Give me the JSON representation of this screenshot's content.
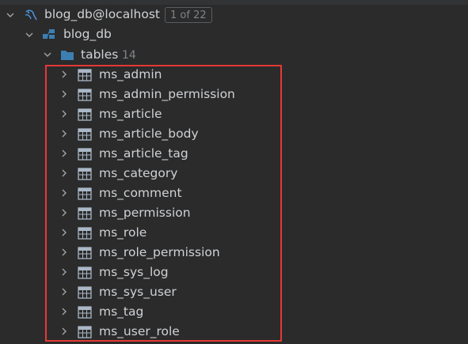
{
  "datasource": {
    "name": "blog_db@localhost",
    "badge": "1 of 22",
    "icon": "datasource-icon"
  },
  "schema": {
    "name": "blog_db",
    "icon": "schema-icon"
  },
  "tables_folder": {
    "label": "tables",
    "count": "14",
    "icon": "folder-icon"
  },
  "tables": [
    {
      "name": "ms_admin"
    },
    {
      "name": "ms_admin_permission"
    },
    {
      "name": "ms_article"
    },
    {
      "name": "ms_article_body"
    },
    {
      "name": "ms_article_tag"
    },
    {
      "name": "ms_category"
    },
    {
      "name": "ms_comment"
    },
    {
      "name": "ms_permission"
    },
    {
      "name": "ms_role"
    },
    {
      "name": "ms_role_permission"
    },
    {
      "name": "ms_sys_log"
    },
    {
      "name": "ms_sys_user"
    },
    {
      "name": "ms_tag"
    },
    {
      "name": "ms_user_role"
    }
  ],
  "colors": {
    "background": "#2b2b2b",
    "text": "#cfd2d6",
    "muted": "#7f848a",
    "highlight": "#e53935",
    "folder": "#3c7fb1",
    "table_icon": "#a9b7c6"
  }
}
